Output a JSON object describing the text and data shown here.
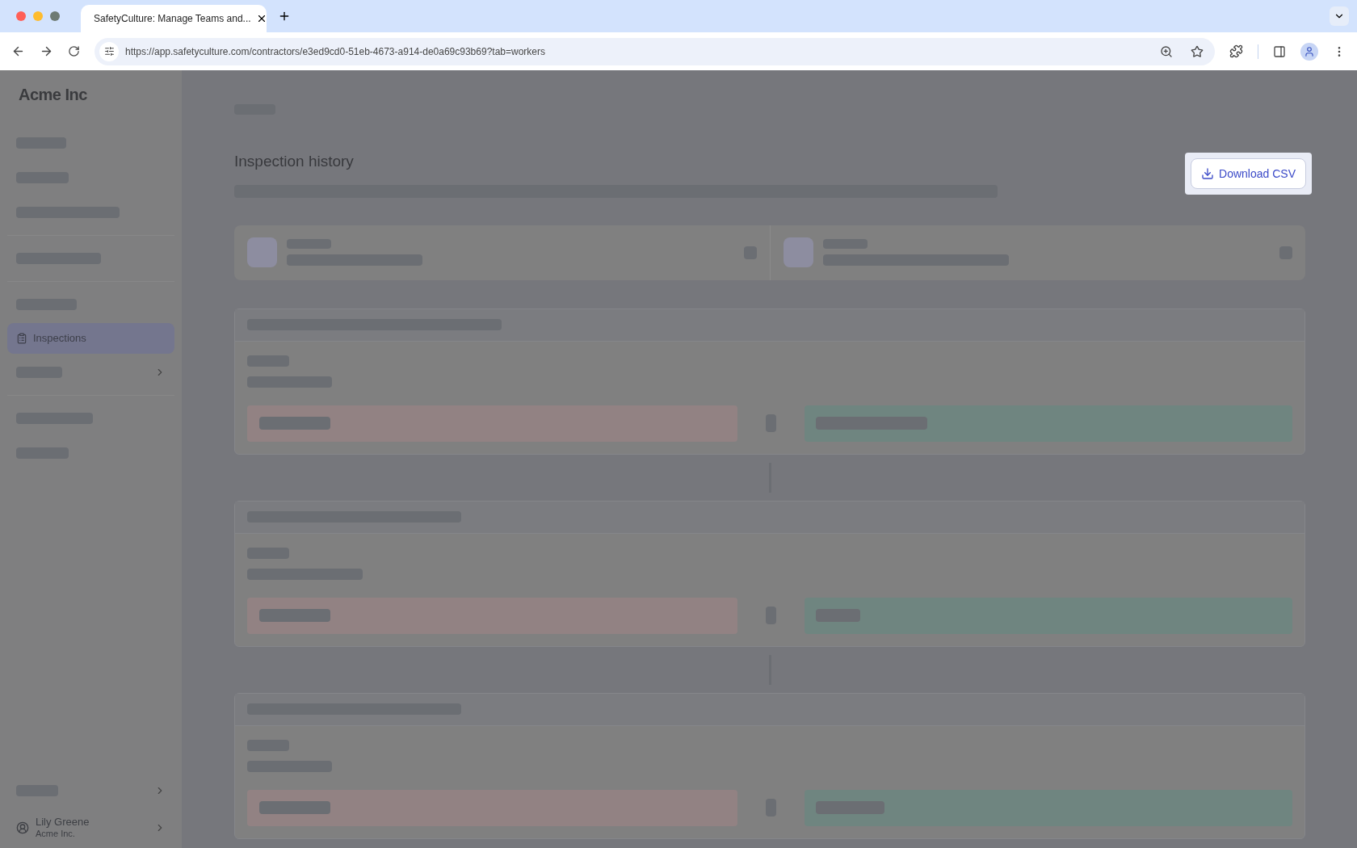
{
  "browser": {
    "tab_title": "SafetyCulture: Manage Teams and...",
    "url": "https://app.safetyculture.com/contractors/e3ed9cd0-51eb-4673-a914-de0a69c93b69?tab=workers"
  },
  "sidebar": {
    "logo": "Acme Inc",
    "items": [
      {
        "label": "Inspections",
        "selected": true
      }
    ],
    "user": {
      "name": "Lily Greene",
      "org": "Acme Inc."
    }
  },
  "page": {
    "title": "Inspection history",
    "download_button": "Download CSV"
  }
}
